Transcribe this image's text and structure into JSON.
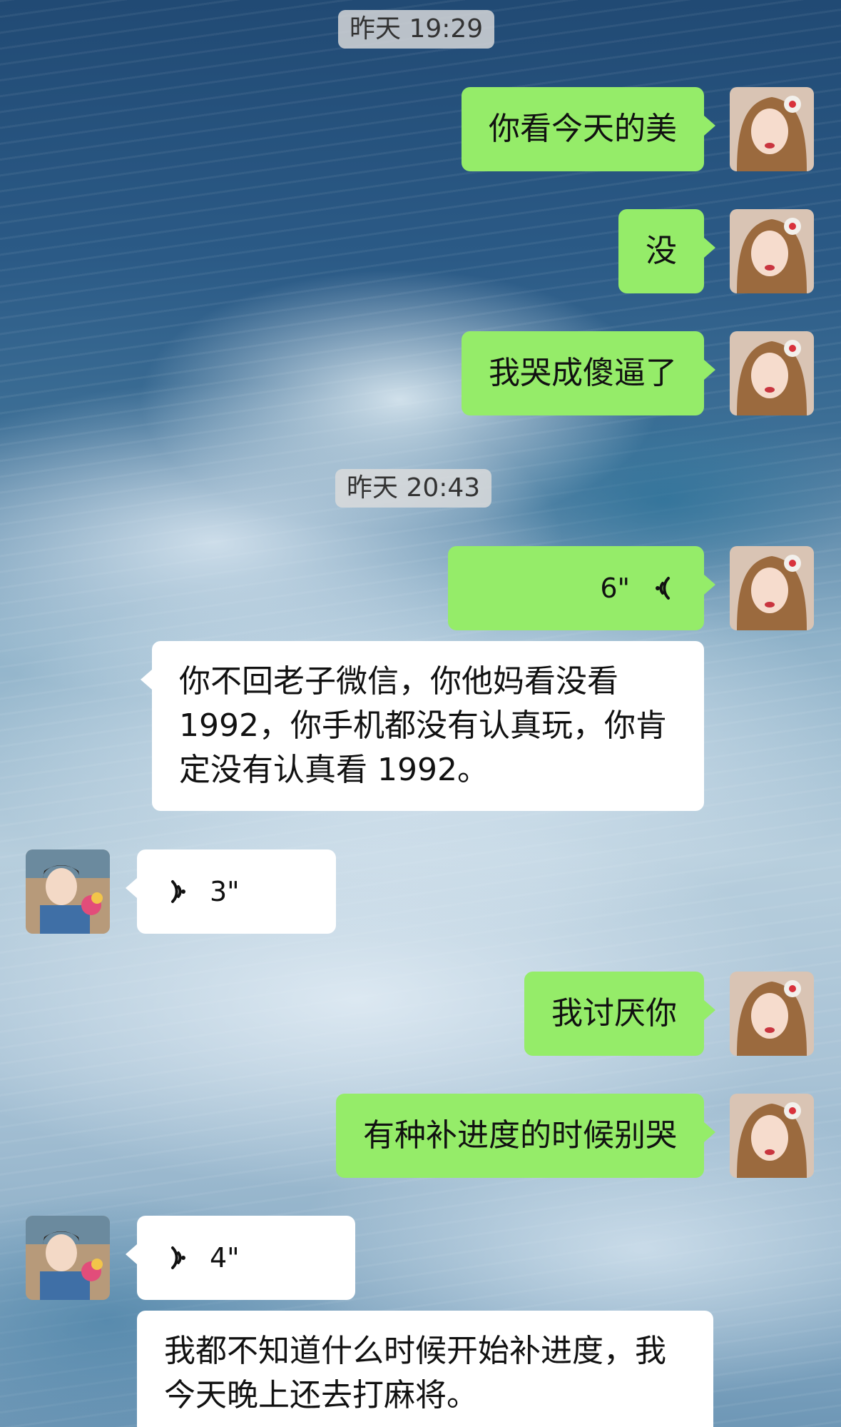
{
  "chat": {
    "timestamps": [
      "昨天 19:29",
      "昨天 20:43"
    ],
    "messages": [
      {
        "sender": "me",
        "type": "text",
        "text": "你看今天的美"
      },
      {
        "sender": "me",
        "type": "text",
        "text": "没"
      },
      {
        "sender": "me",
        "type": "text",
        "text": "我哭成傻逼了"
      },
      {
        "sender": "me",
        "type": "voice",
        "duration": "6\""
      },
      {
        "sender": "me",
        "type": "text",
        "text": "你不回老子微信，你他妈看没看1992，你手机都没有认真玩，你肯定没有认真看 1992。"
      },
      {
        "sender": "them",
        "type": "voice",
        "duration": "3\""
      },
      {
        "sender": "me",
        "type": "text",
        "text": "我讨厌你"
      },
      {
        "sender": "me",
        "type": "text",
        "text": "有种补进度的时候别哭"
      },
      {
        "sender": "them",
        "type": "voice",
        "duration": "4\""
      },
      {
        "sender": "them",
        "type": "text",
        "text": "我都不知道什么时候开始补进度，我今天晚上还去打麻将。"
      }
    ]
  },
  "colors": {
    "my_bubble": "#95ec69",
    "their_bubble": "#ffffff",
    "timestamp_bg": "#dcdcdc"
  },
  "icons": {
    "voice_wave": "voice-wave-icon",
    "my_avatar": "avatar-me",
    "their_avatar": "avatar-them"
  }
}
